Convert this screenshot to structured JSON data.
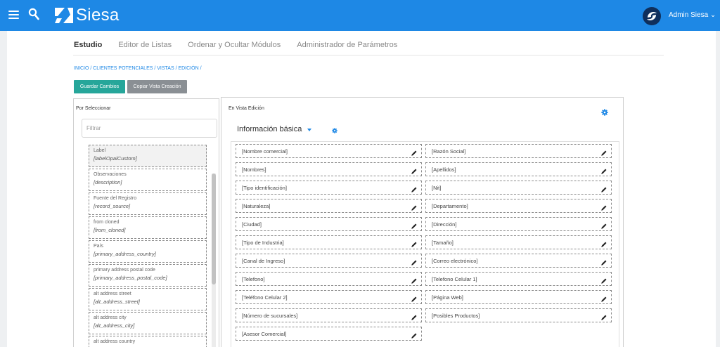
{
  "header": {
    "brand": "Siesa",
    "user_name": "Admin Siesa",
    "accent_color": "#1e88e5",
    "menu_icon": "hamburger-icon",
    "search_icon": "search-icon"
  },
  "tabs": [
    {
      "label": "Estudio",
      "active": true
    },
    {
      "label": "Editor de Listas",
      "active": false
    },
    {
      "label": "Ordenar y Ocultar Módulos",
      "active": false
    },
    {
      "label": "Administrador de Parámetros",
      "active": false
    }
  ],
  "breadcrumb": "INICIO / CLIENTES POTENCIALES / VISTAS / EDICIÓN /",
  "buttons": {
    "save": "Guardar Cambios",
    "copy": "Copiar Vista Creación"
  },
  "left_panel": {
    "title": "Por Seleccionar",
    "filter_placeholder": "Filtrar",
    "items": [
      {
        "label": "Label",
        "key": "[labelOpalCustom]"
      },
      {
        "label": "Observaciones",
        "key": "[description]"
      },
      {
        "label": "Fuente del Registro",
        "key": "[record_source]"
      },
      {
        "label": "from cloned",
        "key": "[from_cloned]"
      },
      {
        "label": "País",
        "key": "[primary_address_country]"
      },
      {
        "label": "primary address postal code",
        "key": "[primary_address_postal_code]"
      },
      {
        "label": "alt address street",
        "key": "[alt_address_street]"
      },
      {
        "label": "alt address city",
        "key": "[alt_address_city]"
      },
      {
        "label": "alt address country",
        "key": ""
      }
    ]
  },
  "right_panel": {
    "title": "En Vista Edición",
    "section_title": "Información básica",
    "fields": [
      "[Nombre comercial]",
      "[Razón Social]",
      "[Nombres]",
      "[Apellidos]",
      "[Tipo identificación]",
      "[Nit]",
      "[Naturaleza]",
      "[Departamento]",
      "[Ciudad]",
      "[Dirección]",
      "[Tipo de Industria]",
      "[Tamaño]",
      "[Canal de Ingreso]",
      "[Correo electrónico]",
      "[Telefono]",
      "[Telefono Celular 1]",
      "[Teléfono Celular 2]",
      "[Página Web]",
      "[Número de sucursales]",
      "[Posibles Productos]",
      "[Asesor Comercial]"
    ]
  }
}
